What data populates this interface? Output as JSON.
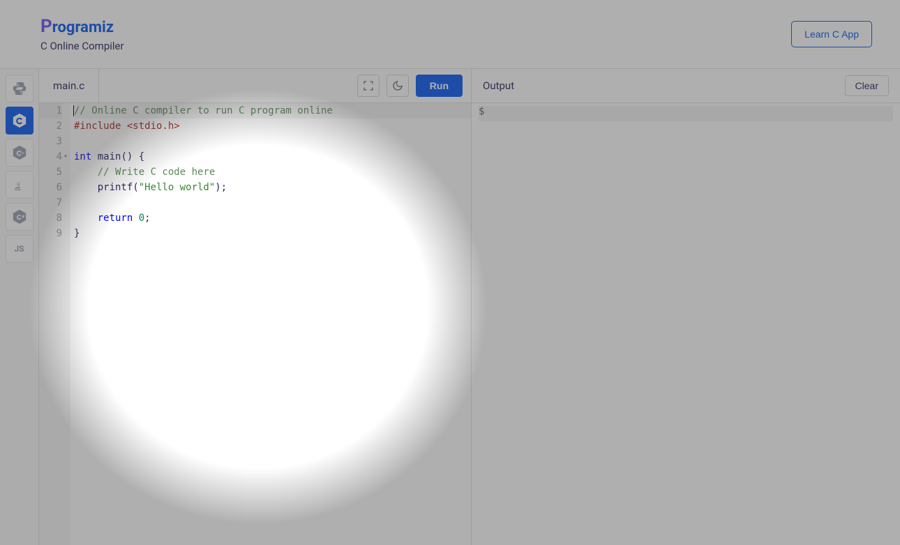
{
  "header": {
    "logo_text": "rogramiz",
    "logo_prefix": "P",
    "subtitle": "C Online Compiler",
    "learn_button": "Learn C App"
  },
  "sidebar": {
    "items": [
      {
        "id": "python",
        "label": "Py",
        "active": false
      },
      {
        "id": "c",
        "label": "C",
        "active": true
      },
      {
        "id": "cpp",
        "label": "C++",
        "active": false
      },
      {
        "id": "java",
        "label": "Java",
        "active": false
      },
      {
        "id": "csharp",
        "label": "C#",
        "active": false
      },
      {
        "id": "js",
        "label": "JS",
        "active": false
      }
    ]
  },
  "editor": {
    "tab_name": "main.c",
    "run_label": "Run",
    "lines": [
      {
        "n": 1,
        "active": true,
        "fold": false,
        "tokens": [
          {
            "t": "// Online C compiler to run C program online",
            "c": "tok-comment"
          }
        ]
      },
      {
        "n": 2,
        "active": false,
        "fold": false,
        "tokens": [
          {
            "t": "#include ",
            "c": "tok-preproc"
          },
          {
            "t": "<stdio.h>",
            "c": "tok-include"
          }
        ]
      },
      {
        "n": 3,
        "active": false,
        "fold": false,
        "tokens": []
      },
      {
        "n": 4,
        "active": false,
        "fold": true,
        "tokens": [
          {
            "t": "int",
            "c": "tok-type"
          },
          {
            "t": " ",
            "c": ""
          },
          {
            "t": "main",
            "c": "tok-func"
          },
          {
            "t": "() {",
            "c": "tok-punct"
          }
        ]
      },
      {
        "n": 5,
        "active": false,
        "fold": false,
        "tokens": [
          {
            "t": "    ",
            "c": ""
          },
          {
            "t": "// Write C code here",
            "c": "tok-comment"
          }
        ]
      },
      {
        "n": 6,
        "active": false,
        "fold": false,
        "tokens": [
          {
            "t": "    printf(",
            "c": "tok-punct"
          },
          {
            "t": "\"Hello world\"",
            "c": "tok-string"
          },
          {
            "t": ");",
            "c": "tok-punct"
          }
        ]
      },
      {
        "n": 7,
        "active": false,
        "fold": false,
        "tokens": []
      },
      {
        "n": 8,
        "active": false,
        "fold": false,
        "tokens": [
          {
            "t": "    ",
            "c": ""
          },
          {
            "t": "return",
            "c": "tok-keyword"
          },
          {
            "t": " ",
            "c": ""
          },
          {
            "t": "0",
            "c": "tok-number"
          },
          {
            "t": ";",
            "c": "tok-punct"
          }
        ]
      },
      {
        "n": 9,
        "active": false,
        "fold": false,
        "tokens": [
          {
            "t": "}",
            "c": "tok-punct"
          }
        ]
      }
    ]
  },
  "output": {
    "title": "Output",
    "clear_label": "Clear",
    "prompt": "$"
  },
  "colors": {
    "accent": "#0556f3"
  }
}
